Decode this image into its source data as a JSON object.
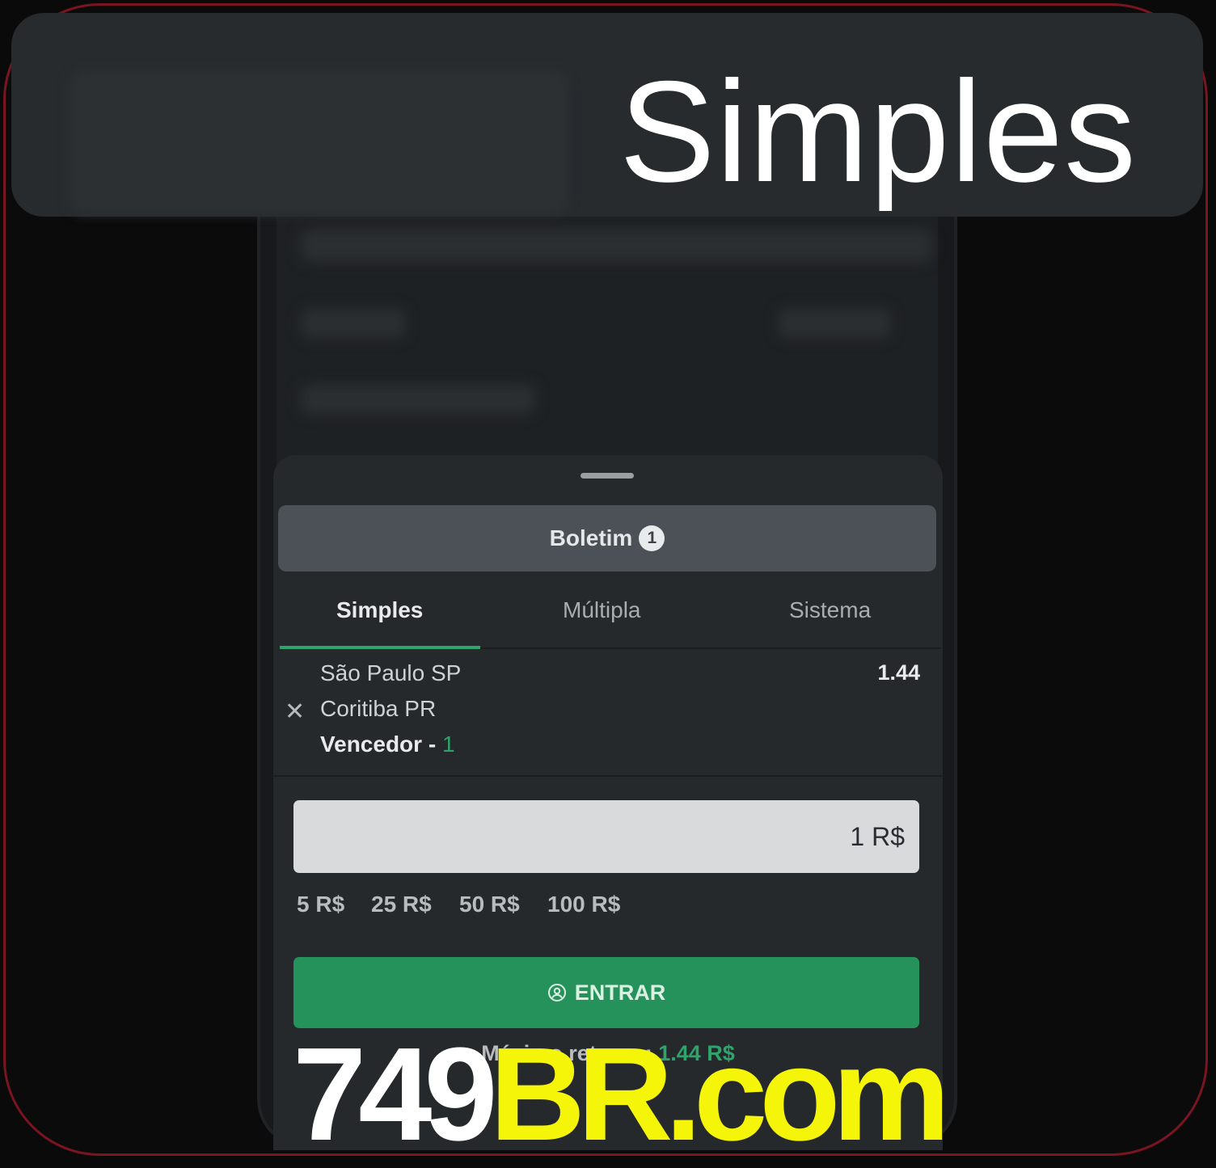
{
  "title": "Simples",
  "betslip": {
    "header_label": "Boletim",
    "header_count": "1",
    "tabs": [
      {
        "label": "Simples",
        "active": true
      },
      {
        "label": "Múltipla",
        "active": false
      },
      {
        "label": "Sistema",
        "active": false
      }
    ],
    "bet": {
      "team_home": "São Paulo SP",
      "team_away": "Coritiba PR",
      "market": "Vencedor -",
      "selection": "1",
      "odds": "1.44",
      "remove_icon": "close-icon"
    },
    "stake_value": "1 R$",
    "quick_amounts": [
      "5 R$",
      "25 R$",
      "50 R$",
      "100 R$"
    ],
    "enter_label": "ENTRAR",
    "enter_icon": "user-circle-icon",
    "max_return_label": "Máximo retorno:",
    "max_return_value": "1.44 R$"
  },
  "brand": {
    "prefix": "749",
    "suffix": "BR.com"
  },
  "colors": {
    "accent_green": "#2ea46b",
    "button_green": "#26925b",
    "brand_yellow": "#f5f50a",
    "frame_border": "#7a1420"
  }
}
